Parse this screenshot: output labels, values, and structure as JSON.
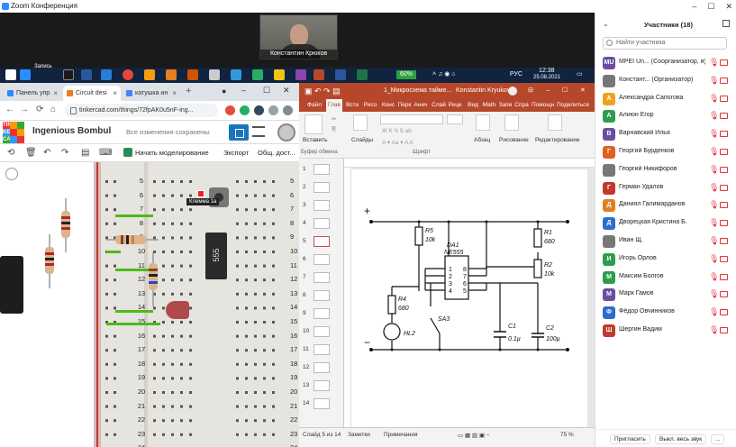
{
  "zoom": {
    "title": "Zoom Конференция"
  },
  "video": {
    "name": "Константин Крюков"
  },
  "taskbar": {
    "battery": "60%",
    "lang": "РУС",
    "time": "12:38",
    "date": "25.08.2021",
    "start_label": "Запись"
  },
  "chrome": {
    "tabs": [
      {
        "label": "Панель упр",
        "color": "#2d8cff"
      },
      {
        "label": "Circuit desi",
        "color": "#e67e22"
      },
      {
        "label": "катушка ин",
        "color": "#4285f4"
      }
    ],
    "url": "tinkercad.com/things/72fpAK0u5nF-ing..."
  },
  "tinkercad": {
    "logo": [
      "TIN",
      "KER",
      "CAD"
    ],
    "project": "Ingenious Bombul",
    "saved": "Все изменения сохранены",
    "sim": "Начать моделирование",
    "export": "Экспорт",
    "share": "Общ. дост...",
    "chip": "555",
    "tooltip": "Клемма 1a",
    "rows": [
      "5",
      "6",
      "7",
      "8",
      "9",
      "10",
      "11",
      "12",
      "13",
      "14",
      "15",
      "16",
      "17",
      "18",
      "19",
      "20",
      "21",
      "22",
      "23",
      "24",
      "25"
    ]
  },
  "word": {
    "title": "1_Микросхема таймe...",
    "user": "Konstantin Kryukov",
    "menu": [
      "Файл",
      "Глав",
      "Вста",
      "Рисо",
      "Конс",
      "Перк",
      "Анич",
      "Слай",
      "Реце",
      "Вид",
      "Math",
      "Запи",
      "Спра"
    ],
    "help": "Помощн",
    "share": "Поделиться",
    "ribbon": {
      "paste": "Вставить",
      "slides": "Слайды",
      "font_group": "Шрифт",
      "clipboard": "Буфер обмена",
      "paragraph": "Абзац",
      "drawing": "Рисование",
      "editing": "Редактирование",
      "font_fmt": "Ж К Ч S ab"
    },
    "slide_numbers": [
      "1",
      "2",
      "3",
      "4",
      "5",
      "6",
      "7",
      "8",
      "9",
      "10",
      "11",
      "12",
      "13",
      "14"
    ],
    "status": {
      "slide": "Слайд 5 из 14",
      "notes": "Заметки",
      "comments": "Примечания",
      "zoom": "75 %"
    },
    "circuit": {
      "da1": "DA1",
      "ne555": "NE555",
      "r5": "R5",
      "r5v": "10k",
      "r1": "R1",
      "r1v": "680",
      "r2": "R2",
      "r2v": "10k",
      "r4": "R4",
      "r4v": "680",
      "c1": "C1",
      "c1v": "0.1µ",
      "c2": "C2",
      "c2v": "100µ",
      "sa3": "SA3",
      "hl2": "HL2",
      "plus": "+",
      "minus": "−",
      "pins": [
        "1",
        "2",
        "3",
        "4",
        "8",
        "7",
        "6",
        "5"
      ]
    }
  },
  "participants": {
    "title": "Участники (18)",
    "search_placeholder": "Найти участника",
    "list": [
      {
        "initials": "MU",
        "name": "МРЕI Un... (Соорганизатор, я)",
        "color": "#6b4ea0"
      },
      {
        "initials": "",
        "name": "Констант... (Организатор)",
        "color": "#777"
      },
      {
        "initials": "А",
        "name": "Александра Сапогова",
        "color": "#f0a020"
      },
      {
        "initials": "А",
        "name": "Алиюн Егор",
        "color": "#2e9e4e"
      },
      {
        "initials": "В",
        "name": "Варнавский Илья",
        "color": "#6b4ea0"
      },
      {
        "initials": "Г",
        "name": "Георгий Бурденков",
        "color": "#e06020"
      },
      {
        "initials": "",
        "name": "Георгий Никифоров",
        "color": "#777"
      },
      {
        "initials": "Г",
        "name": "Герман Удалов",
        "color": "#c0392b"
      },
      {
        "initials": "Д",
        "name": "Даниял Галимарданов",
        "color": "#e08020"
      },
      {
        "initials": "Д",
        "name": "Дворецкая Кристина Б.",
        "color": "#2d6ccf"
      },
      {
        "initials": "",
        "name": "Иван Щ.",
        "color": "#777"
      },
      {
        "initials": "И",
        "name": "Игорь Орлов",
        "color": "#2e9e4e"
      },
      {
        "initials": "М",
        "name": "Максим Болгов",
        "color": "#2e9e4e"
      },
      {
        "initials": "М",
        "name": "Марк Гамов",
        "color": "#6b4ea0"
      },
      {
        "initials": "Ф",
        "name": "Фёдор Овчинников",
        "color": "#2d6ccf"
      },
      {
        "initials": "Ш",
        "name": "Шергин Вадим",
        "color": "#c0392b"
      }
    ],
    "invite": "Пригласить",
    "mute_all": "Выкл. весь звук",
    "more": "..."
  }
}
